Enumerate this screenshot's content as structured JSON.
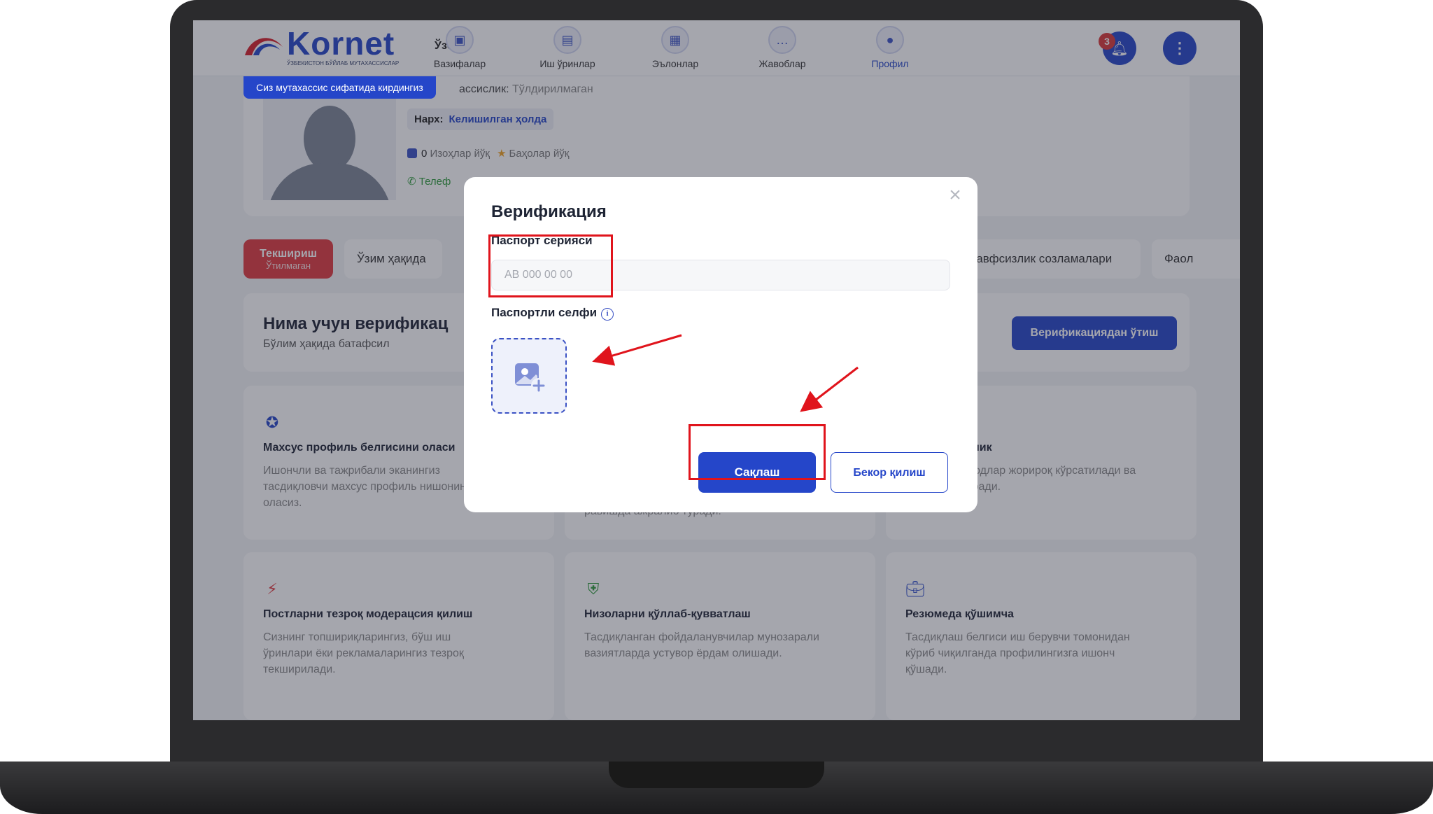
{
  "brand": {
    "name": "Kornet",
    "tagline": "ЎЗБЕКИСТОН БЎЙЛАБ МУТАХАССИСЛАР"
  },
  "header": {
    "language": "Ўзб",
    "nav": [
      {
        "label": "Вазифалар",
        "icon": "tasks-icon"
      },
      {
        "label": "Иш ўринлар",
        "icon": "jobs-icon"
      },
      {
        "label": "Эълонлар",
        "icon": "announcements-icon"
      },
      {
        "label": "Жавоблар",
        "icon": "responses-icon"
      },
      {
        "label": "Профил",
        "icon": "profile-icon",
        "active": true
      }
    ],
    "notification_count": "3"
  },
  "profile": {
    "expert_banner": "Сиз мутахассис сифатида кирдингиз",
    "speciality_label": "ассислик:",
    "speciality_value": "Тўлдирилмаган",
    "price_label": "Нарх:",
    "price_value": "Келишилган ҳолда",
    "reviews_count": "0",
    "reviews_text": "Изоҳлар йўқ",
    "ratings_text": "Баҳолар йўқ",
    "phone_label": "Телеф"
  },
  "tabs": {
    "check_title": "Текшириш",
    "check_status": "Ўтилмаган",
    "about": "Ўзим ҳақида",
    "security": "Хавфсизлик созламалари",
    "activity": "Фаол"
  },
  "why": {
    "title": "Нима учун верификац",
    "subtitle": "Бўлим ҳақида батафсил",
    "button": "Верификациядан ўтиш"
  },
  "features": [
    {
      "icon": "verified-badge-icon",
      "title": "Махсус профиль белгисини оласи",
      "desc": "Ишончли ва тажрибали эканингиз тасдиқловчи махсус профиль нишонини оласиз."
    },
    {
      "icon": "hidden-icon",
      "title": "",
      "desc": "равишда ажралиб туради."
    },
    {
      "icon": "hidden-icon",
      "title": "чун устуворлик",
      "desc": "обингиз номзодлар жорироқ кўрсатилади ва ниятини оширади."
    },
    {
      "icon": "lightning-icon",
      "title": "Постларни тезроқ модерацсия қилиш",
      "desc": "Сизнинг топшириқларингиз, бўш иш ўринлари ёки рекламаларингиз тезроқ текширилади."
    },
    {
      "icon": "shield-check-icon",
      "title": "Низоларни қўллаб-қувватлаш",
      "desc": "Тасдиқланган фойдаланувчилар мунозарали вазиятларда устувор ёрдам олишади."
    },
    {
      "icon": "briefcase-icon",
      "title": "Резюмеда қўшимча",
      "desc": "Тасдиқлаш белгиси иш берувчи томонидан кўриб чиқилганда профилингизга ишонч қўшади."
    }
  ],
  "modal": {
    "title": "Верификация",
    "passport_label": "Паспорт серияси",
    "passport_placeholder": "AB 000 00 00",
    "passport_value": "",
    "selfie_label": "Паспортли селфи",
    "save": "Сақлаш",
    "cancel": "Бекор қилиш"
  },
  "colors": {
    "brand": "#2546c9",
    "danger": "#e0393e",
    "annotation": "#e0141c"
  }
}
